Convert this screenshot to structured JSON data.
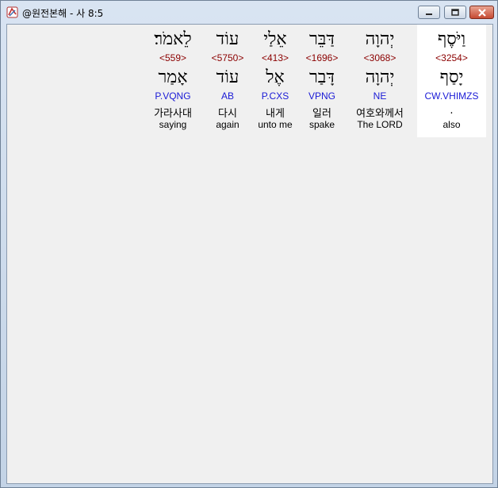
{
  "window": {
    "title": "@원전본해 - 사 8:5"
  },
  "controls": {
    "minimize_icon": "minimize-icon",
    "maximize_icon": "maximize-icon",
    "close_icon": "close-icon"
  },
  "words": [
    {
      "surface": "לֵאמֹר׃",
      "strong": "<559>",
      "lemma": "אָמַר",
      "morph": "P.VQNG",
      "korean": "가라사대",
      "english": "saying"
    },
    {
      "surface": "עוֹד",
      "strong": "<5750>",
      "lemma": "עוֹד",
      "morph": "AB",
      "korean": "다시",
      "english": "again"
    },
    {
      "surface": "אֵלַי",
      "strong": "<413>",
      "lemma": "אֶל",
      "morph": "P.CXS",
      "korean": "내게",
      "english": "unto me"
    },
    {
      "surface": "דַּבֵּר",
      "strong": "<1696>",
      "lemma": "דָּבַר",
      "morph": "VPNG",
      "korean": "일러",
      "english": "spake"
    },
    {
      "surface": "יְהוָה",
      "strong": "<3068>",
      "lemma": "יְהוָה",
      "morph": "NE",
      "korean": "여호와께서",
      "english": "The LORD"
    },
    {
      "surface": "וַיֹּסֶף",
      "strong": "<3254>",
      "lemma": "יָסַף",
      "morph": "CW.VHIMZS",
      "korean": ".",
      "english": "also",
      "highlighted": true
    }
  ],
  "colors": {
    "strong": "#8b0000",
    "morph": "#1a1ad6",
    "highlight_bg": "#ffffff",
    "client_bg": "#f0f0f0"
  }
}
